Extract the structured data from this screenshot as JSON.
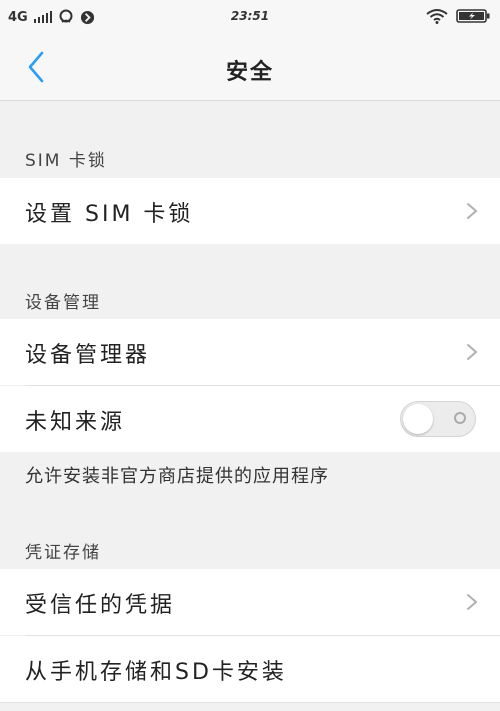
{
  "status_bar": {
    "network": "4G",
    "time": "23:51"
  },
  "header": {
    "title": "安全",
    "back_icon": "chevron-left-icon"
  },
  "sections": {
    "sim": {
      "label": "SIM 卡锁",
      "items": [
        {
          "label": "设置 SIM 卡锁"
        }
      ]
    },
    "device": {
      "label": "设备管理",
      "items": [
        {
          "label": "设备管理器"
        },
        {
          "label": "未知来源",
          "toggle_on": false
        }
      ],
      "unknown_sources_desc": "允许安装非官方商店提供的应用程序"
    },
    "credentials": {
      "label": "凭证存储",
      "items": [
        {
          "label": "受信任的凭据"
        },
        {
          "label": "从手机存储和SD卡安装"
        }
      ]
    }
  },
  "colors": {
    "accent": "#2a9df4",
    "background": "#f1f1f1",
    "row_bg": "#ffffff"
  }
}
